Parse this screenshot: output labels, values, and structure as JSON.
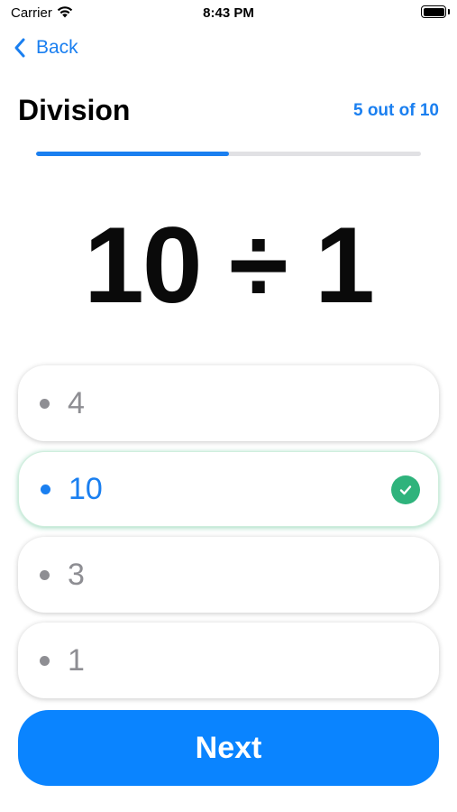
{
  "status_bar": {
    "carrier": "Carrier",
    "time": "8:43 PM"
  },
  "nav": {
    "back_label": "Back"
  },
  "header": {
    "title": "Division",
    "progress_text": "5 out of 10",
    "progress_fraction": 0.5
  },
  "question": {
    "text": "10 ÷ 1"
  },
  "options": [
    {
      "label": "4",
      "selected": false
    },
    {
      "label": "10",
      "selected": true
    },
    {
      "label": "3",
      "selected": false
    },
    {
      "label": "1",
      "selected": false
    }
  ],
  "next_button": {
    "label": "Next"
  },
  "colors": {
    "accent": "#1a7ff0",
    "button": "#0a84ff",
    "correct": "#2fb37c",
    "unselected": "#8e8e93",
    "track": "#e1e1e4"
  }
}
